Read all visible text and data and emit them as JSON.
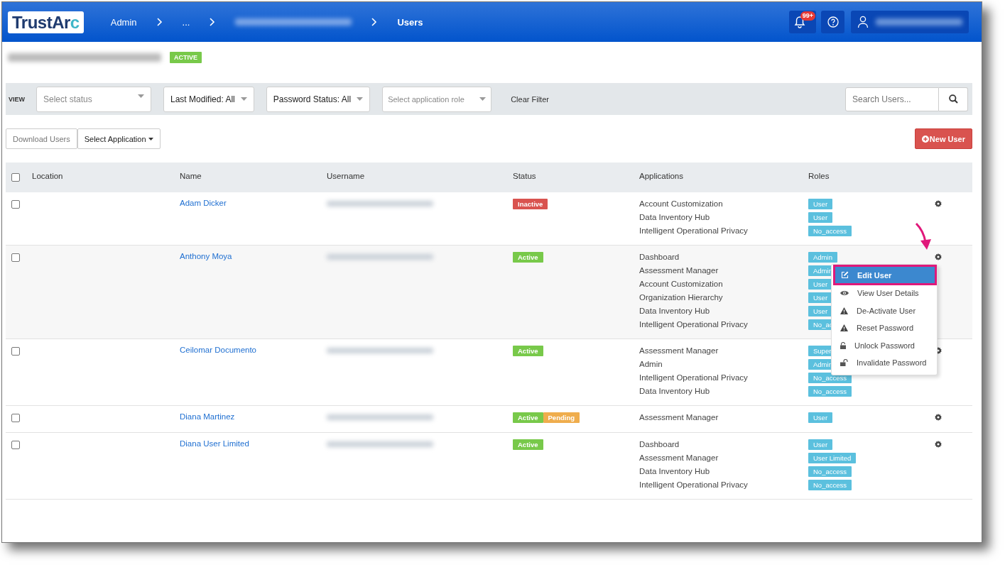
{
  "header": {
    "logo": {
      "main": "TrustAr",
      "accent": "c"
    },
    "breadcrumbs": [
      {
        "label": "Admin",
        "kind": "text"
      },
      {
        "label": "...",
        "kind": "text"
      },
      {
        "kind": "blurred"
      },
      {
        "label": "Users",
        "kind": "current"
      }
    ],
    "notifications": {
      "badge": "99+"
    }
  },
  "account": {
    "status": "ACTIVE"
  },
  "filters": {
    "label": "VIEW",
    "dropdowns": [
      {
        "text": "Select status",
        "kind": "placeholder"
      },
      {
        "text": "Last Modified: All",
        "kind": "value"
      },
      {
        "text": "Password Status: All",
        "kind": "value"
      },
      {
        "text": "Select application role",
        "kind": "placeholder"
      }
    ],
    "clear": "Clear Filter",
    "search": {
      "placeholder": "Search Users..."
    }
  },
  "actions": {
    "download": "Download Users",
    "select_application": "Select Application",
    "new_user": "New User"
  },
  "table": {
    "columns": [
      "Location",
      "Name",
      "Username",
      "Status",
      "Applications",
      "Roles"
    ],
    "all_checked": false,
    "rows": [
      {
        "checked": false,
        "menu_open": false,
        "name": "Adam Dicker",
        "statuses": [
          {
            "label": "Inactive",
            "kind": "inactive"
          }
        ],
        "applications": [
          "Account Customization",
          "Data Inventory Hub",
          "Intelligent Operational Privacy"
        ],
        "roles": [
          "User",
          "User",
          "No_access"
        ]
      },
      {
        "checked": false,
        "name": "Anthony Moya",
        "statuses": [
          {
            "label": "Active",
            "kind": "active"
          }
        ],
        "applications": [
          "Dashboard",
          "Assessment Manager",
          "Account Customization",
          "Organization Hierarchy",
          "Data Inventory Hub",
          "Intelligent Operational Privacy"
        ],
        "roles": [
          "Admin",
          "Admin",
          "User",
          "User",
          "User",
          "No_ac"
        ],
        "menu_open": true
      },
      {
        "checked": false,
        "menu_open": false,
        "name": "Ceilomar Documento",
        "statuses": [
          {
            "label": "Active",
            "kind": "active"
          }
        ],
        "applications": [
          "Assessment Manager",
          "Admin",
          "Intelligent Operational Privacy",
          "Data Inventory Hub"
        ],
        "roles": [
          "Super",
          "Admin",
          "No_access",
          "No_access"
        ]
      },
      {
        "checked": false,
        "menu_open": false,
        "name": "Diana Martinez",
        "statuses": [
          {
            "label": "Active",
            "kind": "active"
          },
          {
            "label": "Pending",
            "kind": "pending"
          }
        ],
        "applications": [
          "Assessment Manager"
        ],
        "roles": [
          "User"
        ]
      },
      {
        "checked": false,
        "menu_open": false,
        "name": "Diana User Limited",
        "statuses": [
          {
            "label": "Active",
            "kind": "active"
          }
        ],
        "applications": [
          "Dashboard",
          "Assessment Manager",
          "Data Inventory Hub",
          "Intelligent Operational Privacy"
        ],
        "roles": [
          "User",
          "User Limited",
          "No_access",
          "No_access"
        ]
      }
    ]
  },
  "context_menu": {
    "items": [
      {
        "label": "Edit User",
        "kind": "edit",
        "selected": true
      },
      {
        "label": "View User Details",
        "kind": "view",
        "selected": false
      },
      {
        "label": "De-Activate User",
        "kind": "deactivate",
        "selected": false
      },
      {
        "label": "Reset Password",
        "kind": "reset",
        "selected": false
      },
      {
        "label": "Unlock Password",
        "kind": "unlock",
        "selected": false
      },
      {
        "label": "Invalidate Password",
        "kind": "invalidate",
        "selected": false
      }
    ]
  }
}
